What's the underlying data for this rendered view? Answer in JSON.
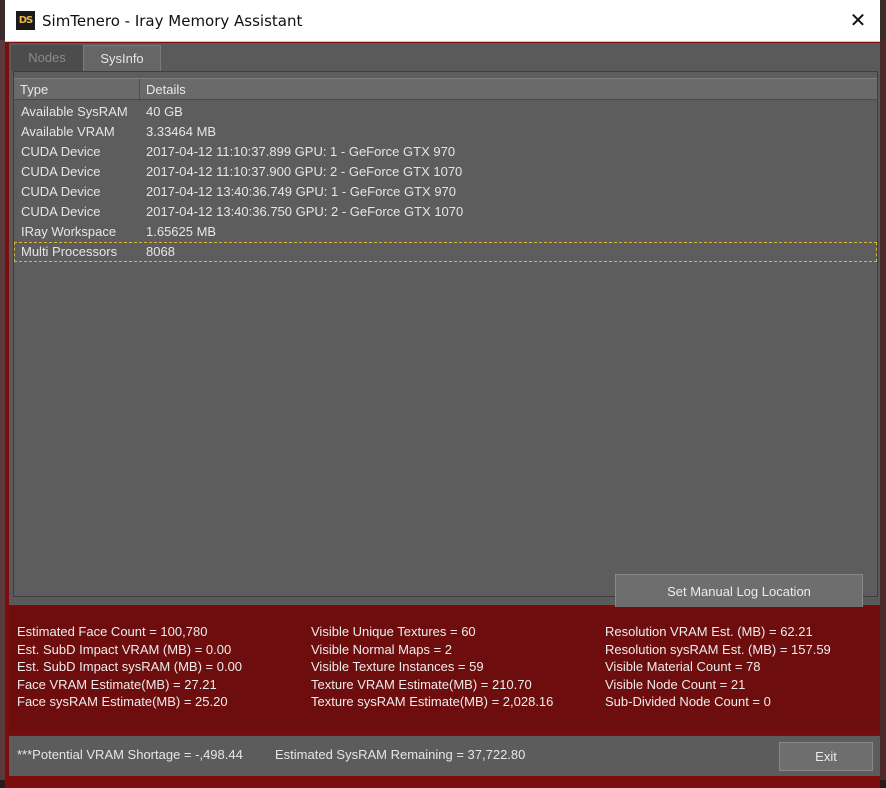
{
  "window": {
    "app_icon_text": "DS",
    "title": "SimTenero - Iray Memory Assistant",
    "close_glyph": "✕"
  },
  "tabs": [
    {
      "label": "Nodes",
      "active": false
    },
    {
      "label": "SysInfo",
      "active": true
    }
  ],
  "table": {
    "headers": [
      "Type",
      "Details"
    ],
    "rows": [
      {
        "type": "Available SysRAM",
        "details": "40 GB"
      },
      {
        "type": "Available VRAM",
        "details": "3.33464 MB"
      },
      {
        "type": "CUDA Device",
        "details": "2017-04-12 11:10:37.899  GPU: 1 - GeForce GTX 970"
      },
      {
        "type": "CUDA Device",
        "details": "2017-04-12 11:10:37.900  GPU: 2 - GeForce GTX 1070"
      },
      {
        "type": "CUDA Device",
        "details": "2017-04-12 13:40:36.749  GPU: 1 - GeForce GTX 970"
      },
      {
        "type": "CUDA Device",
        "details": "2017-04-12 13:40:36.750  GPU: 2 - GeForce GTX 1070"
      },
      {
        "type": "IRay Workspace",
        "details": "1.65625 MB"
      },
      {
        "type": "Multi Processors",
        "details": "8068"
      }
    ],
    "selected_row": "Multi Processors"
  },
  "buttons": {
    "log_location": "Set Manual Log Location",
    "exit": "Exit"
  },
  "stats": {
    "col1": [
      "Estimated Face Count = 100,780",
      "Est. SubD Impact VRAM (MB) = 0.00",
      "Est. SubD Impact sysRAM (MB) = 0.00",
      "Face VRAM Estimate(MB) = 27.21",
      "Face sysRAM Estimate(MB) = 25.20"
    ],
    "col2": [
      "Visible Unique Textures = 60",
      "Visible Normal Maps = 2",
      "Visible Texture Instances = 59",
      "Texture VRAM Estimate(MB) = 210.70",
      "Texture sysRAM Estimate(MB) = 2,028.16"
    ],
    "col3": [
      "Resolution VRAM Est. (MB) = 62.21",
      "Resolution sysRAM Est. (MB) = 157.59",
      "Visible Material Count = 78",
      "Visible Node Count = 21",
      "Sub-Divided Node Count = 0"
    ]
  },
  "footer": {
    "vram_shortage": "***Potential VRAM Shortage = -,498.44",
    "sysram_remaining": "Estimated SysRAM Remaining = 37,722.80"
  },
  "colors": {
    "accent_dark_red": "#7a0e0e",
    "panel_gray": "#5a5a5a",
    "selection_outline": "#e0b23a"
  }
}
